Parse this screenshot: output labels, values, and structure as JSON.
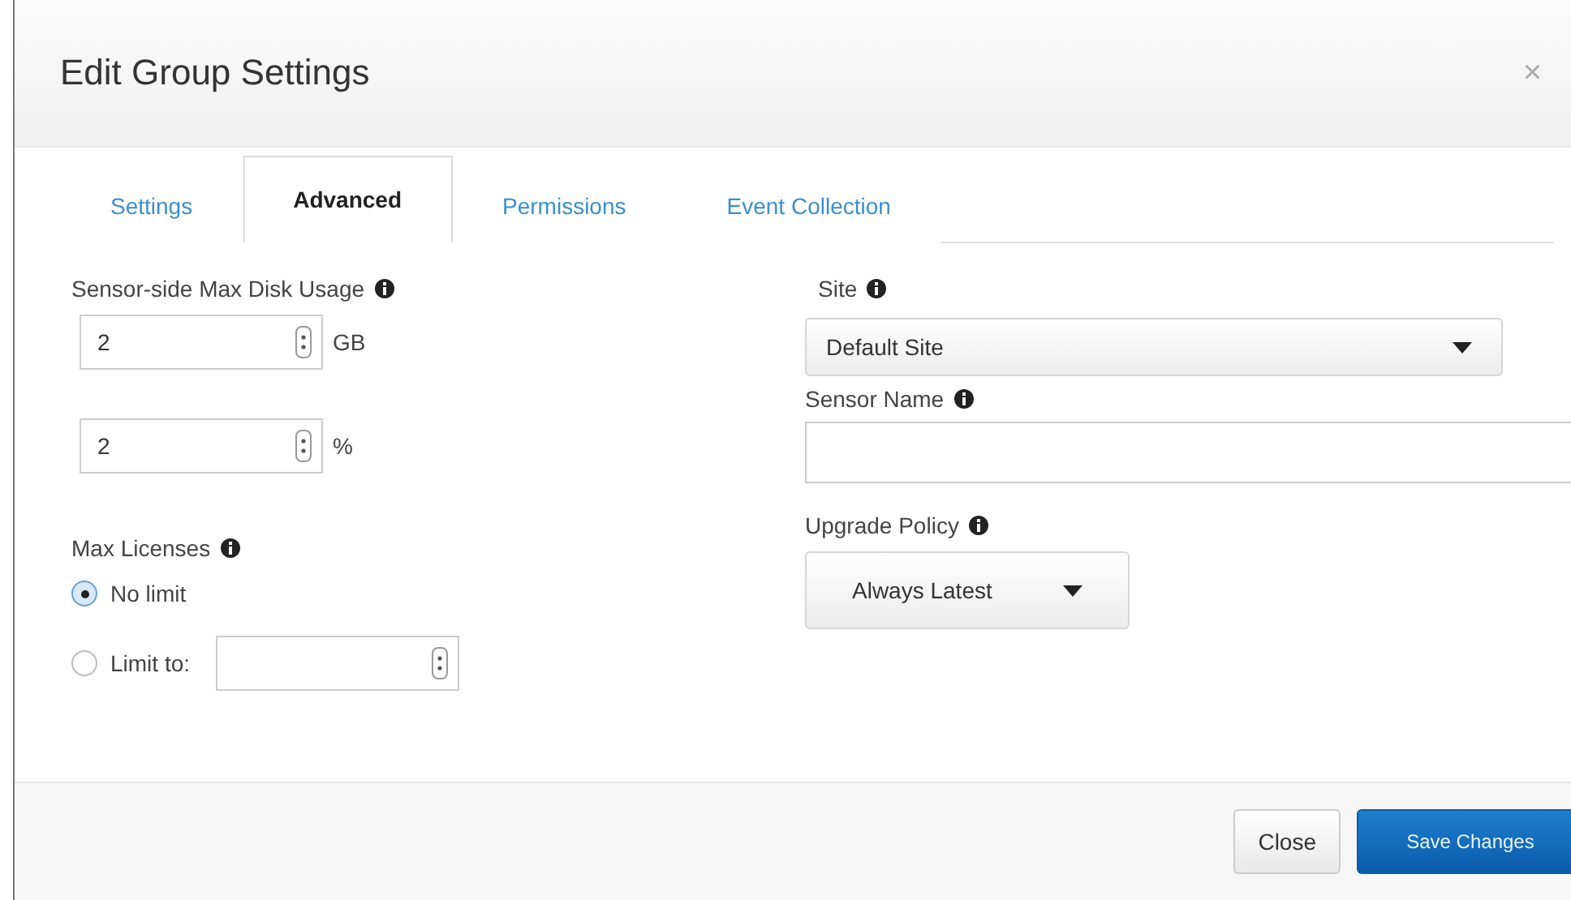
{
  "dialog": {
    "title": "Edit Group Settings",
    "close": "×"
  },
  "tabs": [
    {
      "label": "Settings",
      "selected": false
    },
    {
      "label": "Advanced",
      "selected": true
    },
    {
      "label": "Permissions",
      "selected": false
    },
    {
      "label": "Event Collection",
      "selected": false
    }
  ],
  "disk_usage": {
    "label": "Sensor-side Max Disk Usage",
    "fields": [
      {
        "value": "2",
        "unit": "GB"
      },
      {
        "value": "2",
        "unit": "%"
      }
    ]
  },
  "max_licenses": {
    "label": "Max Licenses",
    "options": [
      {
        "label": "No limit",
        "selected": true
      },
      {
        "label": "Limit to:",
        "selected": false,
        "kind": "number"
      }
    ]
  },
  "site": {
    "label": "Site",
    "value": "Default Site"
  },
  "sensor_name": {
    "label": "Sensor Name"
  },
  "upgrade_policy": {
    "label": "Upgrade Policy",
    "value": "Always Latest"
  },
  "buttons": [
    {
      "label": "Close",
      "kind": "secondary"
    },
    {
      "label": "Save Changes",
      "kind": "primary"
    }
  ]
}
